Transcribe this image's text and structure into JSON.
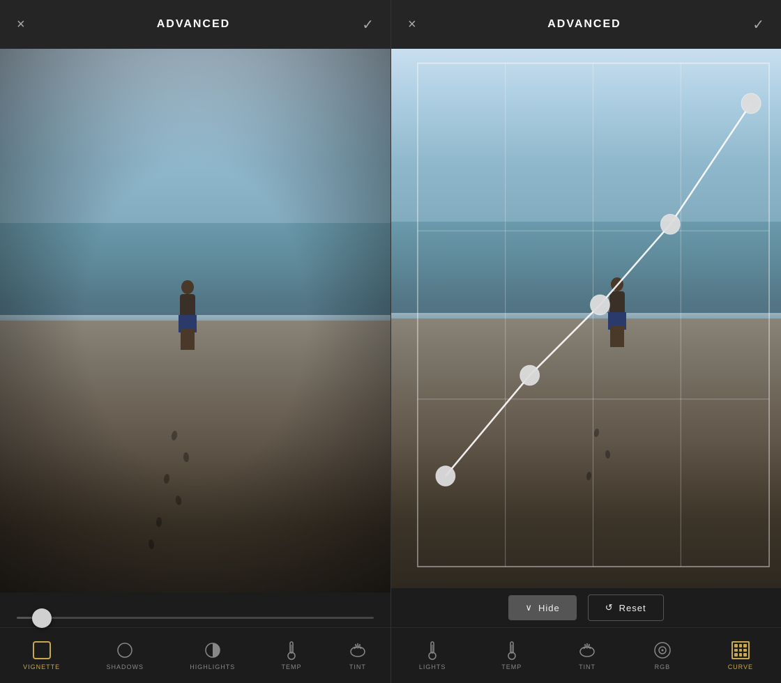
{
  "left_panel": {
    "header": {
      "title": "ADVANCED",
      "close_label": "×",
      "confirm_label": "✓"
    },
    "tabs": [
      {
        "id": "vignette",
        "label": "VIGNETTE",
        "active": true,
        "icon": "square"
      },
      {
        "id": "shadows",
        "label": "SHADOWS",
        "active": false,
        "icon": "circle"
      },
      {
        "id": "highlights",
        "label": "HIGHLIGHTS",
        "active": false,
        "icon": "circle-half"
      },
      {
        "id": "temp",
        "label": "TEMP",
        "active": false,
        "icon": "thermometer"
      },
      {
        "id": "tint",
        "label": "TINT",
        "active": false,
        "icon": "cat"
      }
    ],
    "slider": {
      "value": 7,
      "min": 0,
      "max": 100
    }
  },
  "right_panel": {
    "header": {
      "title": "ADVANCED",
      "close_label": "×",
      "confirm_label": "✓"
    },
    "tabs": [
      {
        "id": "lights",
        "label": "LIGHTS",
        "active": false,
        "icon": "thermometer"
      },
      {
        "id": "temp",
        "label": "TEMP",
        "active": false,
        "icon": "thermometer"
      },
      {
        "id": "tint",
        "label": "TINT",
        "active": false,
        "icon": "cat"
      },
      {
        "id": "rgb",
        "label": "RGB",
        "active": false,
        "icon": "circle-target"
      },
      {
        "id": "curve",
        "label": "CURVE",
        "active": true,
        "icon": "grid"
      }
    ],
    "curve": {
      "points": [
        {
          "x": 0.08,
          "y": 0.82
        },
        {
          "x": 0.32,
          "y": 0.62
        },
        {
          "x": 0.52,
          "y": 0.48
        },
        {
          "x": 0.72,
          "y": 0.32
        },
        {
          "x": 0.95,
          "y": 0.08
        }
      ]
    },
    "buttons": {
      "hide_label": "Hide",
      "reset_label": "Reset"
    }
  }
}
